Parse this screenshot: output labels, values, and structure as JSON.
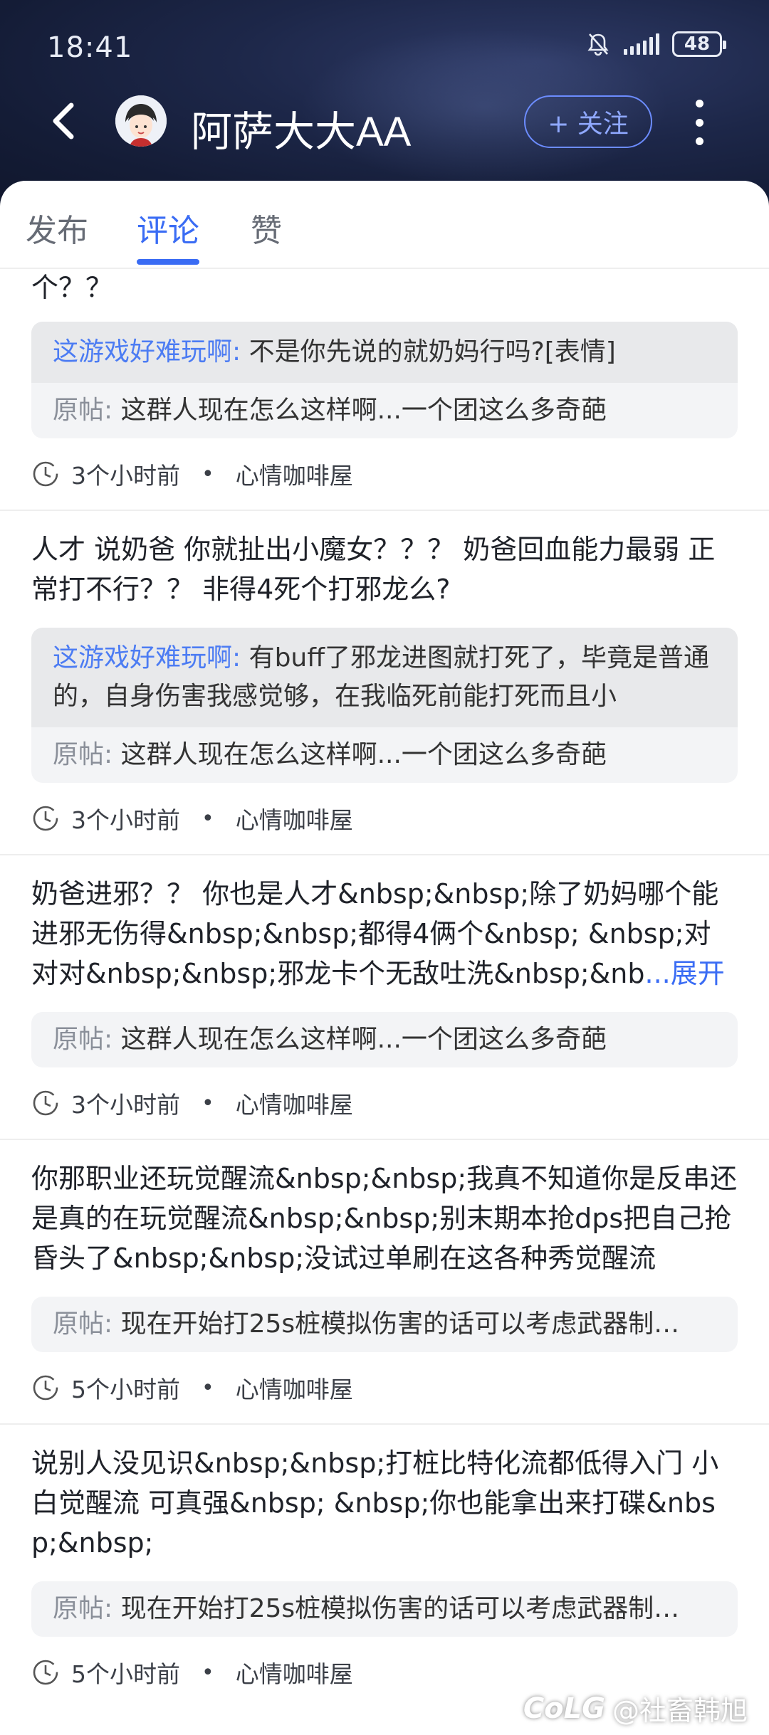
{
  "status_bar": {
    "time": "18:41",
    "battery": "48"
  },
  "header": {
    "name": "阿萨大大AA",
    "follow_label": "+ 关注"
  },
  "tabs": [
    {
      "label": "发布",
      "active": false
    },
    {
      "label": "评论",
      "active": true
    },
    {
      "label": "赞",
      "active": false
    }
  ],
  "items": [
    {
      "text": "个？？",
      "reply_author": "这游戏好难玩啊:",
      "reply_text": " 不是你先说的就奶妈行吗?[表情]",
      "orig_label": "原帖:",
      "orig_text": " 这群人现在怎么这样啊...一个团这么多奇葩",
      "time": "3个小时前",
      "forum": "心情咖啡屋"
    },
    {
      "text": "人才 说奶爸 你就扯出小魔女？？？ 奶爸回血能力最弱 正常打不行？？ 非得4死个打邪龙么?",
      "reply_author": "这游戏好难玩啊:",
      "reply_text": " 有buff了邪龙进图就打死了，毕竟是普通的，自身伤害我感觉够，在我临死前能打死而且小",
      "orig_label": "原帖:",
      "orig_text": " 这群人现在怎么这样啊...一个团这么多奇葩",
      "time": "3个小时前",
      "forum": "心情咖啡屋"
    },
    {
      "text": "奶爸进邪？？ 你也是人才&nbsp;&nbsp;除了奶妈哪个能进邪无伤得&nbsp;&nbsp;都得4俩个&nbsp; &nbsp;对对对&nbsp;&nbsp;邪龙卡个无敌吐洗&nbsp;&nb",
      "expand": "...展开",
      "orig_label": "原帖:",
      "orig_text": " 这群人现在怎么这样啊...一个团这么多奇葩",
      "time": "3个小时前",
      "forum": "心情咖啡屋"
    },
    {
      "text": "你那职业还玩觉醒流&nbsp;&nbsp;我真不知道你是反串还是真的在玩觉醒流&nbsp;&nbsp;别末期本抢dps把自己抢昏头了&nbsp;&nbsp;没试过单刷在这各种秀觉醒流",
      "orig_label": "原帖:",
      "orig_text": " 现在开始打25s桩模拟伤害的话可以考虑武器制…",
      "time": "5个小时前",
      "forum": "心情咖啡屋"
    },
    {
      "text": "说别人没见识&nbsp;&nbsp;打桩比特化流都低得入门 小白觉醒流 可真强&nbsp; &nbsp;你也能拿出来打碟&nbsp;&nbsp;",
      "orig_label": "原帖:",
      "orig_text": " 现在开始打25s桩模拟伤害的话可以考虑武器制…",
      "time": "5个小时前",
      "forum": "心情咖啡屋"
    }
  ],
  "watermark": {
    "logo": "CoLG",
    "text": "@社畜韩旭"
  }
}
